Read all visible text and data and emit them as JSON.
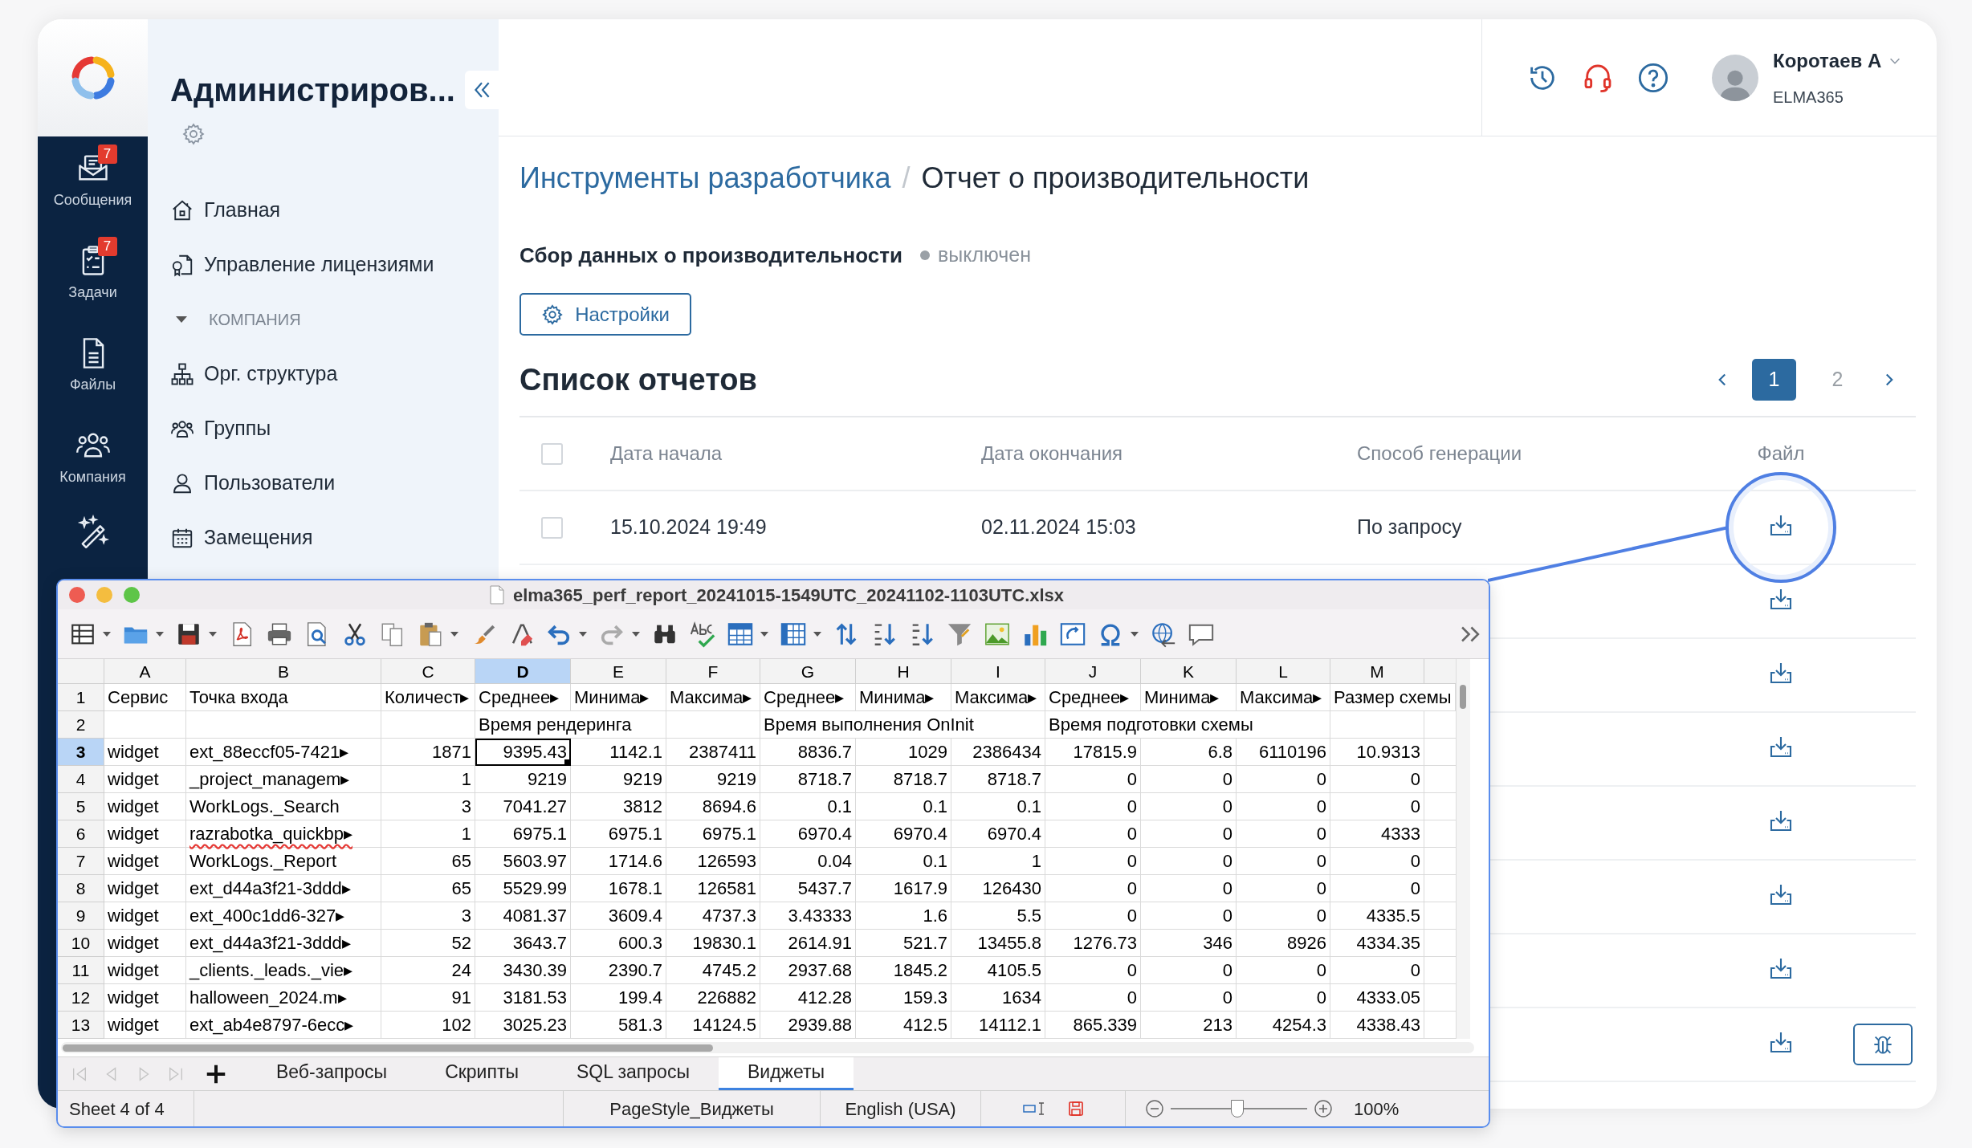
{
  "rail": {
    "items": [
      {
        "label": "Сообщения",
        "badge": "7"
      },
      {
        "label": "Задачи",
        "badge": "7"
      },
      {
        "label": "Файлы"
      },
      {
        "label": "Компания"
      }
    ]
  },
  "sidebar": {
    "title": "Администриров...",
    "items": [
      {
        "label": "Главная",
        "kind": "link"
      },
      {
        "label": "Управление лицензиями",
        "kind": "link"
      },
      {
        "label": "КОМПАНИЯ",
        "kind": "section",
        "expanded": true,
        "children": [
          {
            "label": "Орг. структура",
            "kind": "link"
          },
          {
            "label": "Группы",
            "kind": "link"
          },
          {
            "label": "Пользователи",
            "kind": "link"
          },
          {
            "label": "Замещения",
            "kind": "link"
          }
        ]
      }
    ]
  },
  "header": {
    "user": {
      "name": "Коротаев А",
      "org": "ELMA365"
    }
  },
  "breadcrumb": {
    "separator": "/",
    "items": [
      {
        "label": "Инструменты разработчика",
        "kind": "link"
      },
      {
        "label": "Отчет о производительности",
        "kind": "current"
      }
    ]
  },
  "collection": {
    "label": "Сбор данных о производительности",
    "status": "выключен",
    "on": false
  },
  "settings_button": "Настройки",
  "reports": {
    "title": "Список отчетов",
    "pages": [
      {
        "label": "1",
        "selected": true
      },
      {
        "label": "2",
        "selected": false
      }
    ],
    "all_checked": false,
    "columns": [
      "Дата начала",
      "Дата окончания",
      "Способ генерации",
      "Файл"
    ],
    "rows": [
      {
        "kind": "full",
        "checked": false,
        "callout": true,
        "start": "15.10.2024 19:49",
        "end": "02.11.2024 15:03",
        "method": "По запросу"
      },
      {
        "kind": "covered",
        "callout": false
      },
      {
        "kind": "covered",
        "callout": false
      },
      {
        "kind": "covered",
        "callout": false
      },
      {
        "kind": "covered",
        "callout": false
      },
      {
        "kind": "covered",
        "callout": false
      },
      {
        "kind": "covered",
        "callout": false
      },
      {
        "kind": "covered",
        "callout": false,
        "debug_button": true
      }
    ]
  },
  "spreadsheet": {
    "title": "elma365_perf_report_20241015-1549UTC_20241102-1103UTC.xlsx",
    "columns": [
      {
        "label": "A",
        "selected": false
      },
      {
        "label": "B",
        "selected": false
      },
      {
        "label": "C",
        "selected": false
      },
      {
        "label": "D",
        "selected": true
      },
      {
        "label": "E",
        "selected": false
      },
      {
        "label": "F",
        "selected": false
      },
      {
        "label": "G",
        "selected": false
      },
      {
        "label": "H",
        "selected": false
      },
      {
        "label": "I",
        "selected": false
      },
      {
        "label": "J",
        "selected": false
      },
      {
        "label": "K",
        "selected": false
      },
      {
        "label": "L",
        "selected": false
      },
      {
        "label": "M",
        "selected": false
      }
    ],
    "rows": [
      {
        "number": "1",
        "kind": "header",
        "selected": false,
        "cells": [
          "Сервис",
          "Точка входа",
          "Количест▸",
          "Среднее▸",
          "Минима▸",
          "Максима▸",
          "Среднее▸",
          "Минима▸",
          "Максима▸",
          "Среднее▸",
          "Минима▸",
          "Максима▸",
          "Размер схемы"
        ]
      },
      {
        "number": "2",
        "kind": "merged",
        "selected": false,
        "cells": [
          "",
          "",
          "",
          "Время рендеринга",
          "",
          "",
          "Время выполнения OnInit",
          "",
          "",
          "Время подготовки схемы",
          "",
          "",
          ""
        ]
      },
      {
        "number": "3",
        "kind": "data",
        "selected": true,
        "cells": [
          "widget",
          "ext_88eccf05-7421▸",
          "1871",
          "9395.43",
          "1142.1",
          "2387411",
          "8836.7",
          "1029",
          "2386434",
          "17815.9",
          "6.8",
          "6110196",
          "10.9313"
        ]
      },
      {
        "number": "4",
        "kind": "data",
        "selected": false,
        "cells": [
          "widget",
          "_project_managem▸",
          "1",
          "9219",
          "9219",
          "9219",
          "8718.7",
          "8718.7",
          "8718.7",
          "0",
          "0",
          "0",
          "0"
        ]
      },
      {
        "number": "5",
        "kind": "data",
        "selected": false,
        "cells": [
          "widget",
          "WorkLogs._Search",
          "3",
          "7041.27",
          "3812",
          "8694.6",
          "0.1",
          "0.1",
          "0.1",
          "0",
          "0",
          "0",
          "0"
        ]
      },
      {
        "number": "6",
        "kind": "data",
        "selected": false,
        "spellcheck_flag": true,
        "cells": [
          "widget",
          "razrabotka_quickbp▸",
          "1",
          "6975.1",
          "6975.1",
          "6975.1",
          "6970.4",
          "6970.4",
          "6970.4",
          "0",
          "0",
          "0",
          "4333"
        ]
      },
      {
        "number": "7",
        "kind": "data",
        "selected": false,
        "cells": [
          "widget",
          "WorkLogs._Report",
          "65",
          "5603.97",
          "1714.6",
          "126593",
          "0.04",
          "0.1",
          "1",
          "0",
          "0",
          "0",
          "0"
        ]
      },
      {
        "number": "8",
        "kind": "data",
        "selected": false,
        "cells": [
          "widget",
          "ext_d44a3f21-3ddd▸",
          "65",
          "5529.99",
          "1678.1",
          "126581",
          "5437.7",
          "1617.9",
          "126430",
          "0",
          "0",
          "0",
          "0"
        ]
      },
      {
        "number": "9",
        "kind": "data",
        "selected": false,
        "cells": [
          "widget",
          "ext_400c1dd6-327▸",
          "3",
          "4081.37",
          "3609.4",
          "4737.3",
          "3.43333",
          "1.6",
          "5.5",
          "0",
          "0",
          "0",
          "4335.5"
        ]
      },
      {
        "number": "10",
        "kind": "data",
        "selected": false,
        "cells": [
          "widget",
          "ext_d44a3f21-3ddd▸",
          "52",
          "3643.7",
          "600.3",
          "19830.1",
          "2614.91",
          "521.7",
          "13455.8",
          "1276.73",
          "346",
          "8926",
          "4334.35"
        ]
      },
      {
        "number": "11",
        "kind": "data",
        "selected": false,
        "cells": [
          "widget",
          "_clients._leads._vie▸",
          "24",
          "3430.39",
          "2390.7",
          "4745.2",
          "2937.68",
          "1845.2",
          "4105.5",
          "0",
          "0",
          "0",
          "0"
        ]
      },
      {
        "number": "12",
        "kind": "data",
        "selected": false,
        "cells": [
          "widget",
          "halloween_2024.m▸",
          "91",
          "3181.53",
          "199.4",
          "226882",
          "412.28",
          "159.3",
          "1634",
          "0",
          "0",
          "0",
          "4333.05"
        ]
      },
      {
        "number": "13",
        "kind": "data",
        "selected": false,
        "cells": [
          "widget",
          "ext_ab4e8797-6ecc▸",
          "102",
          "3025.23",
          "581.3",
          "14124.5",
          "2939.88",
          "412.5",
          "14112.1",
          "865.339",
          "213",
          "4254.3",
          "4338.43"
        ]
      }
    ],
    "sheets": [
      {
        "label": "Веб-запросы",
        "selected": false
      },
      {
        "label": "Скрипты",
        "selected": false
      },
      {
        "label": "SQL запросы",
        "selected": false
      },
      {
        "label": "Виджеты",
        "selected": true
      }
    ],
    "status": {
      "sheet": "Sheet 4 of 4",
      "page_style": "PageStyle_Виджеты",
      "language": "English (USA)",
      "zoom": "100%"
    },
    "zoom_slider": {
      "level": 0.49
    }
  }
}
